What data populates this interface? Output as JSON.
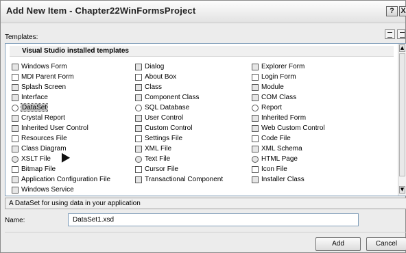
{
  "window": {
    "title": "Add New Item - Chapter22WinFormsProject",
    "help_label": "?",
    "close_label": "X"
  },
  "templates": {
    "label": "Templates:",
    "group_header": "Visual Studio installed templates",
    "columns": [
      [
        {
          "label": "Windows Form",
          "icon": "windows-form-icon"
        },
        {
          "label": "MDI Parent Form",
          "icon": "mdi-parent-form-icon"
        },
        {
          "label": "Splash Screen",
          "icon": "splash-screen-icon"
        },
        {
          "label": "Interface",
          "icon": "interface-icon"
        },
        {
          "label": "DataSet",
          "icon": "dataset-icon",
          "selected": true
        },
        {
          "label": "Crystal Report",
          "icon": "crystal-report-icon"
        },
        {
          "label": "Inherited User Control",
          "icon": "inherited-user-control-icon"
        },
        {
          "label": "Resources File",
          "icon": "resources-file-icon"
        },
        {
          "label": "Class Diagram",
          "icon": "class-diagram-icon"
        },
        {
          "label": "XSLT File",
          "icon": "xslt-file-icon"
        },
        {
          "label": "Bitmap File",
          "icon": "bitmap-file-icon"
        },
        {
          "label": "Application Configuration File",
          "icon": "application-configuration-file-icon"
        },
        {
          "label": "Windows Service",
          "icon": "windows-service-icon"
        }
      ],
      [
        {
          "label": "Dialog",
          "icon": "dialog-icon"
        },
        {
          "label": "About Box",
          "icon": "about-box-icon"
        },
        {
          "label": "Class",
          "icon": "class-icon"
        },
        {
          "label": "Component Class",
          "icon": "component-class-icon"
        },
        {
          "label": "SQL Database",
          "icon": "sql-database-icon"
        },
        {
          "label": "User Control",
          "icon": "user-control-icon"
        },
        {
          "label": "Custom Control",
          "icon": "custom-control-icon"
        },
        {
          "label": "Settings File",
          "icon": "settings-file-icon"
        },
        {
          "label": "XML File",
          "icon": "xml-file-icon"
        },
        {
          "label": "Text File",
          "icon": "text-file-icon"
        },
        {
          "label": "Cursor File",
          "icon": "cursor-file-icon"
        },
        {
          "label": "Transactional Component",
          "icon": "transactional-component-icon"
        }
      ],
      [
        {
          "label": "Explorer Form",
          "icon": "explorer-form-icon"
        },
        {
          "label": "Login Form",
          "icon": "login-form-icon"
        },
        {
          "label": "Module",
          "icon": "module-icon"
        },
        {
          "label": "COM Class",
          "icon": "com-class-icon"
        },
        {
          "label": "Report",
          "icon": "report-icon"
        },
        {
          "label": "Inherited Form",
          "icon": "inherited-form-icon"
        },
        {
          "label": "Web Custom Control",
          "icon": "web-custom-control-icon"
        },
        {
          "label": "Code File",
          "icon": "code-file-icon"
        },
        {
          "label": "XML Schema",
          "icon": "xml-schema-icon"
        },
        {
          "label": "HTML Page",
          "icon": "html-page-icon"
        },
        {
          "label": "Icon File",
          "icon": "icon-file-icon"
        },
        {
          "label": "Installer Class",
          "icon": "installer-class-icon"
        }
      ]
    ]
  },
  "description": "A DataSet for using data in your application",
  "name_field": {
    "label": "Name:",
    "value": "DataSet1.xsd"
  },
  "buttons": {
    "add": "Add",
    "cancel": "Cancel"
  }
}
